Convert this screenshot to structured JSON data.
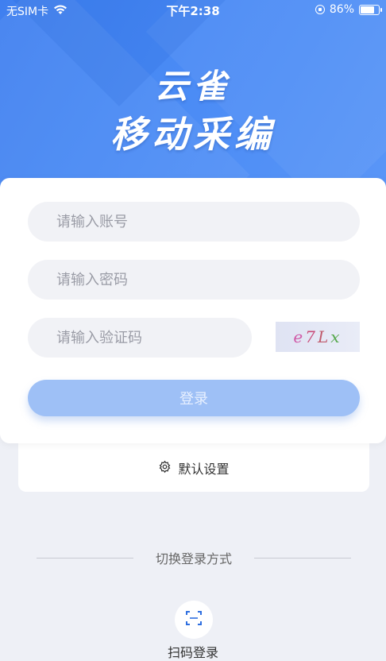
{
  "status_bar": {
    "carrier": "无SIM卡",
    "time": "下午2:38",
    "battery": "86%",
    "battery_level": 0.86
  },
  "header": {
    "title_line1": "云雀",
    "title_line2": "移动采编",
    "accent_color": "#4a8bf5"
  },
  "login_form": {
    "account_placeholder": "请输入账号",
    "password_placeholder": "请输入密码",
    "captcha_placeholder": "请输入验证码",
    "captcha_chars": [
      "e",
      "7",
      "L",
      "x"
    ],
    "login_label": "登录",
    "login_button_color": "#9ec0f6"
  },
  "settings": {
    "default_settings_label": "默认设置",
    "icon": "gear-icon"
  },
  "alt_login": {
    "switch_label": "切换登录方式",
    "scan_label": "扫码登录",
    "icon": "scan-icon"
  }
}
